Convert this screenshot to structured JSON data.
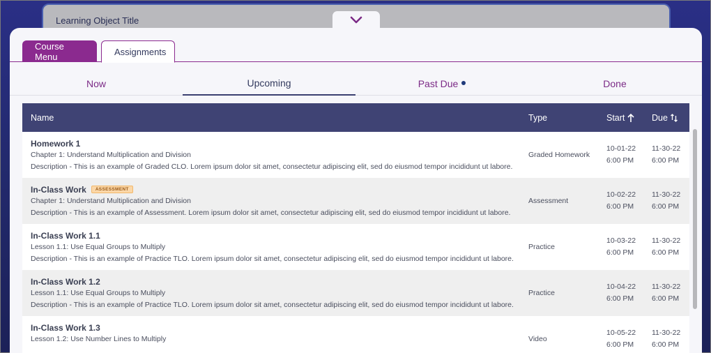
{
  "learning_object": {
    "title": "Learning Object Title"
  },
  "tabs": [
    {
      "label": "Course Menu",
      "active": false
    },
    {
      "label": "Assignments",
      "active": true
    }
  ],
  "subtabs": [
    {
      "label": "Now",
      "active": false,
      "dot": false
    },
    {
      "label": "Upcoming",
      "active": true,
      "dot": false
    },
    {
      "label": "Past Due",
      "active": false,
      "dot": true
    },
    {
      "label": "Done",
      "active": false,
      "dot": false
    }
  ],
  "table": {
    "columns": {
      "name": "Name",
      "type": "Type",
      "start": "Start",
      "due": "Due"
    },
    "rows": [
      {
        "title": "Homework 1",
        "badge": "",
        "subtitle": "Chapter 1: Understand Multiplication and Division",
        "description": "Description - This is an example of Graded CLO. Lorem ipsum dolor sit amet, consectetur adipiscing elit, sed do eiusmod tempor incididunt ut labore.",
        "type": "Graded Homework",
        "start_date": "10-01-22",
        "start_time": "6:00 PM",
        "due_date": "11-30-22",
        "due_time": "6:00 PM"
      },
      {
        "title": "In-Class Work",
        "badge": "ASSESSMENT",
        "subtitle": "Chapter 1: Understand Multiplication and Division",
        "description": "Description - This is an example of Assessment. Lorem ipsum dolor sit amet, consectetur adipiscing elit, sed do eiusmod tempor incididunt ut labore.",
        "type": "Assessment",
        "start_date": "10-02-22",
        "start_time": "6:00 PM",
        "due_date": "11-30-22",
        "due_time": "6:00 PM"
      },
      {
        "title": "In-Class Work 1.1",
        "badge": "",
        "subtitle": "Lesson 1.1: Use Equal Groups to Multiply",
        "description": "Description - This is an example of Practice TLO. Lorem ipsum dolor sit amet, consectetur adipiscing elit, sed do eiusmod tempor incididunt ut labore.",
        "type": "Practice",
        "start_date": "10-03-22",
        "start_time": "6:00 PM",
        "due_date": "11-30-22",
        "due_time": "6:00 PM"
      },
      {
        "title": "In-Class Work 1.2",
        "badge": "",
        "subtitle": "Lesson 1.1: Use Equal Groups to Multiply",
        "description": "Description - This is an example of Practice TLO. Lorem ipsum dolor sit amet, consectetur adipiscing elit, sed do eiusmod tempor incididunt ut labore.",
        "type": "Practice",
        "start_date": "10-04-22",
        "start_time": "6:00 PM",
        "due_date": "11-30-22",
        "due_time": "6:00 PM"
      },
      {
        "title": "In-Class Work 1.3",
        "badge": "",
        "subtitle": "Lesson 1.2: Use Number Lines to Multiply",
        "description": "",
        "type": "Video",
        "start_date": "10-05-22",
        "start_time": "6:00 PM",
        "due_date": "11-30-22",
        "due_time": "6:00 PM"
      }
    ]
  },
  "colors": {
    "accent": "#8b2a8f",
    "header": "#3f4374",
    "badge_bg": "#fbd7a8"
  }
}
